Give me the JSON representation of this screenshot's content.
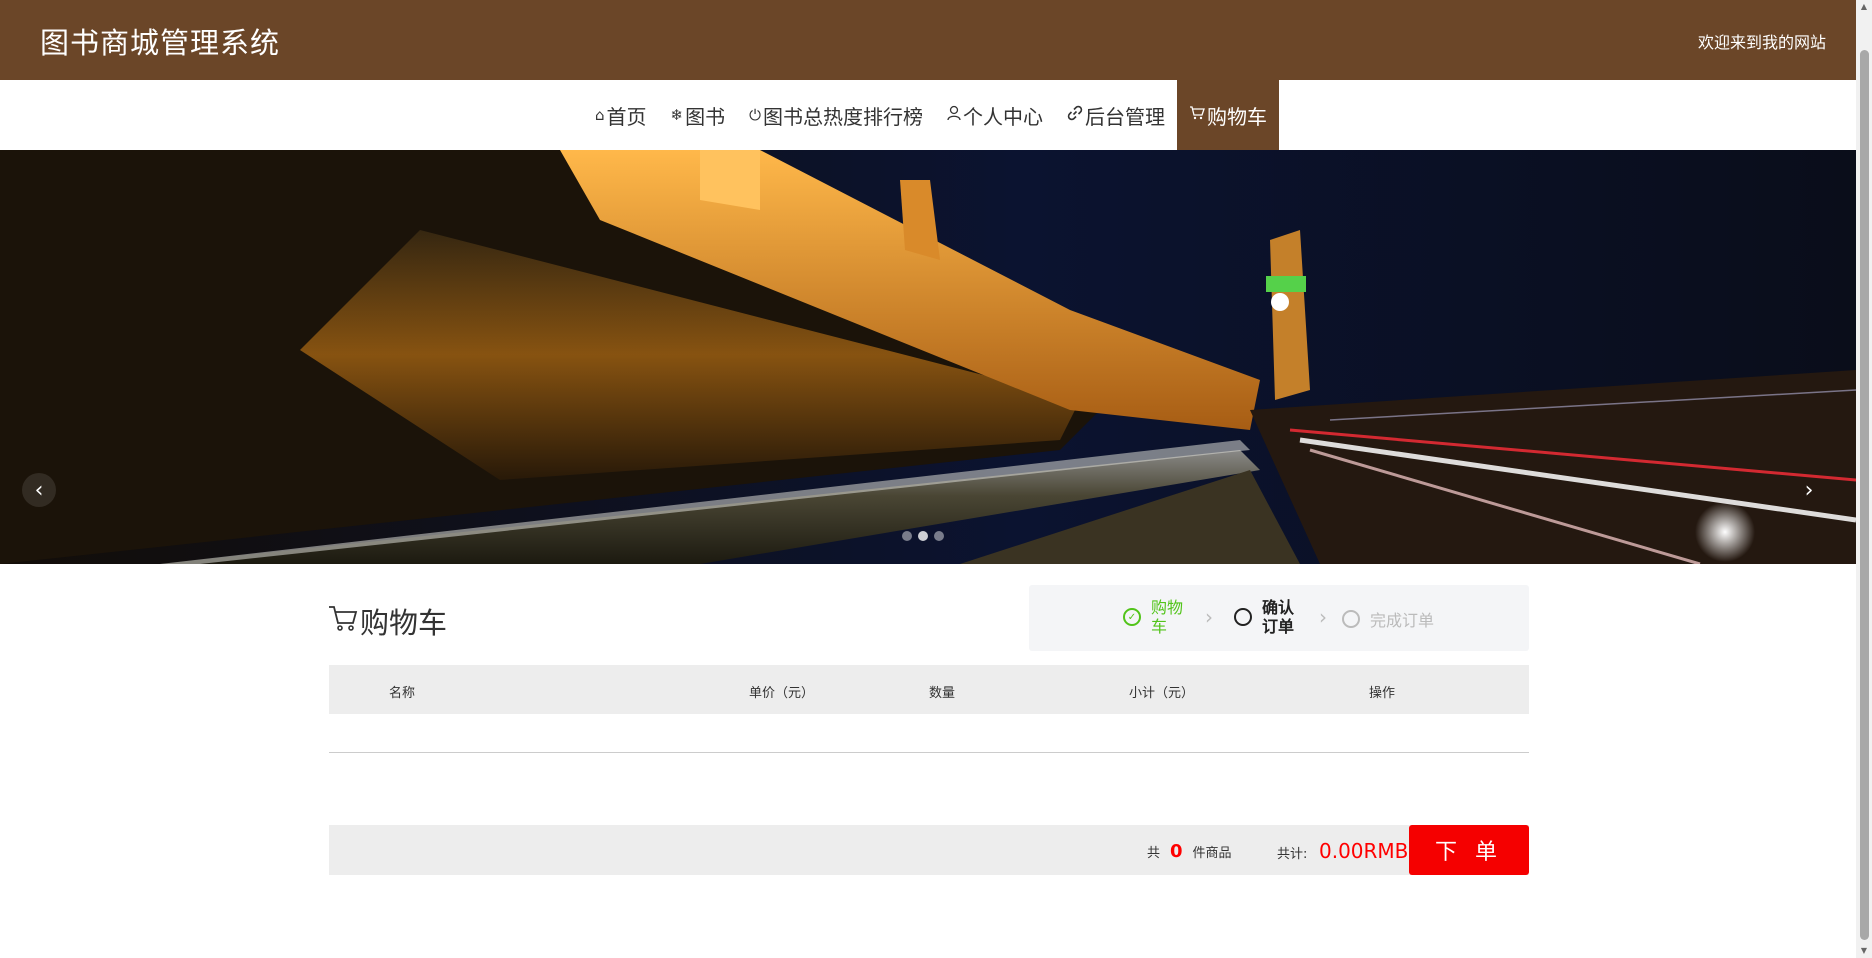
{
  "header": {
    "site_title": "图书商城管理系统",
    "welcome": "欢迎来到我的网站",
    "bg_color": "#6b4628"
  },
  "nav": {
    "items": [
      {
        "label": "首页",
        "icon": "home-icon",
        "glyph": "⌂"
      },
      {
        "label": "图书",
        "icon": "snowflake-icon",
        "glyph": "❄"
      },
      {
        "label": "图书总热度排行榜",
        "icon": "power-icon",
        "glyph": "⏻"
      },
      {
        "label": "个人中心",
        "icon": "user-icon",
        "glyph": "♙"
      },
      {
        "label": "后台管理",
        "icon": "link-icon",
        "glyph": "🔗"
      },
      {
        "label": "购物车",
        "icon": "cart-icon",
        "glyph": "🛒"
      }
    ],
    "active_index": 5
  },
  "banner": {
    "prev_icon": "chevron-left-icon",
    "next_icon": "chevron-right-icon",
    "prev_glyph": "‹",
    "next_glyph": "›",
    "dot_count": 3,
    "active_dot": 1
  },
  "cart": {
    "title": "购物车",
    "title_icon": "cart-icon",
    "steps": [
      {
        "label": "购物车",
        "state": "done"
      },
      {
        "label": "确认订单",
        "state": "current"
      },
      {
        "label": "完成订单",
        "state": "pending"
      }
    ],
    "table": {
      "columns": [
        "名称",
        "单价（元）",
        "数量",
        "小计（元）",
        "操作"
      ]
    },
    "summary": {
      "count_prefix": "共",
      "count": "0",
      "count_suffix": "件商品",
      "total_label": "共计:",
      "total_value": "0.00RMB",
      "order_button": "下 单"
    },
    "accent_color": "#f50000",
    "done_color": "#52c41a"
  }
}
